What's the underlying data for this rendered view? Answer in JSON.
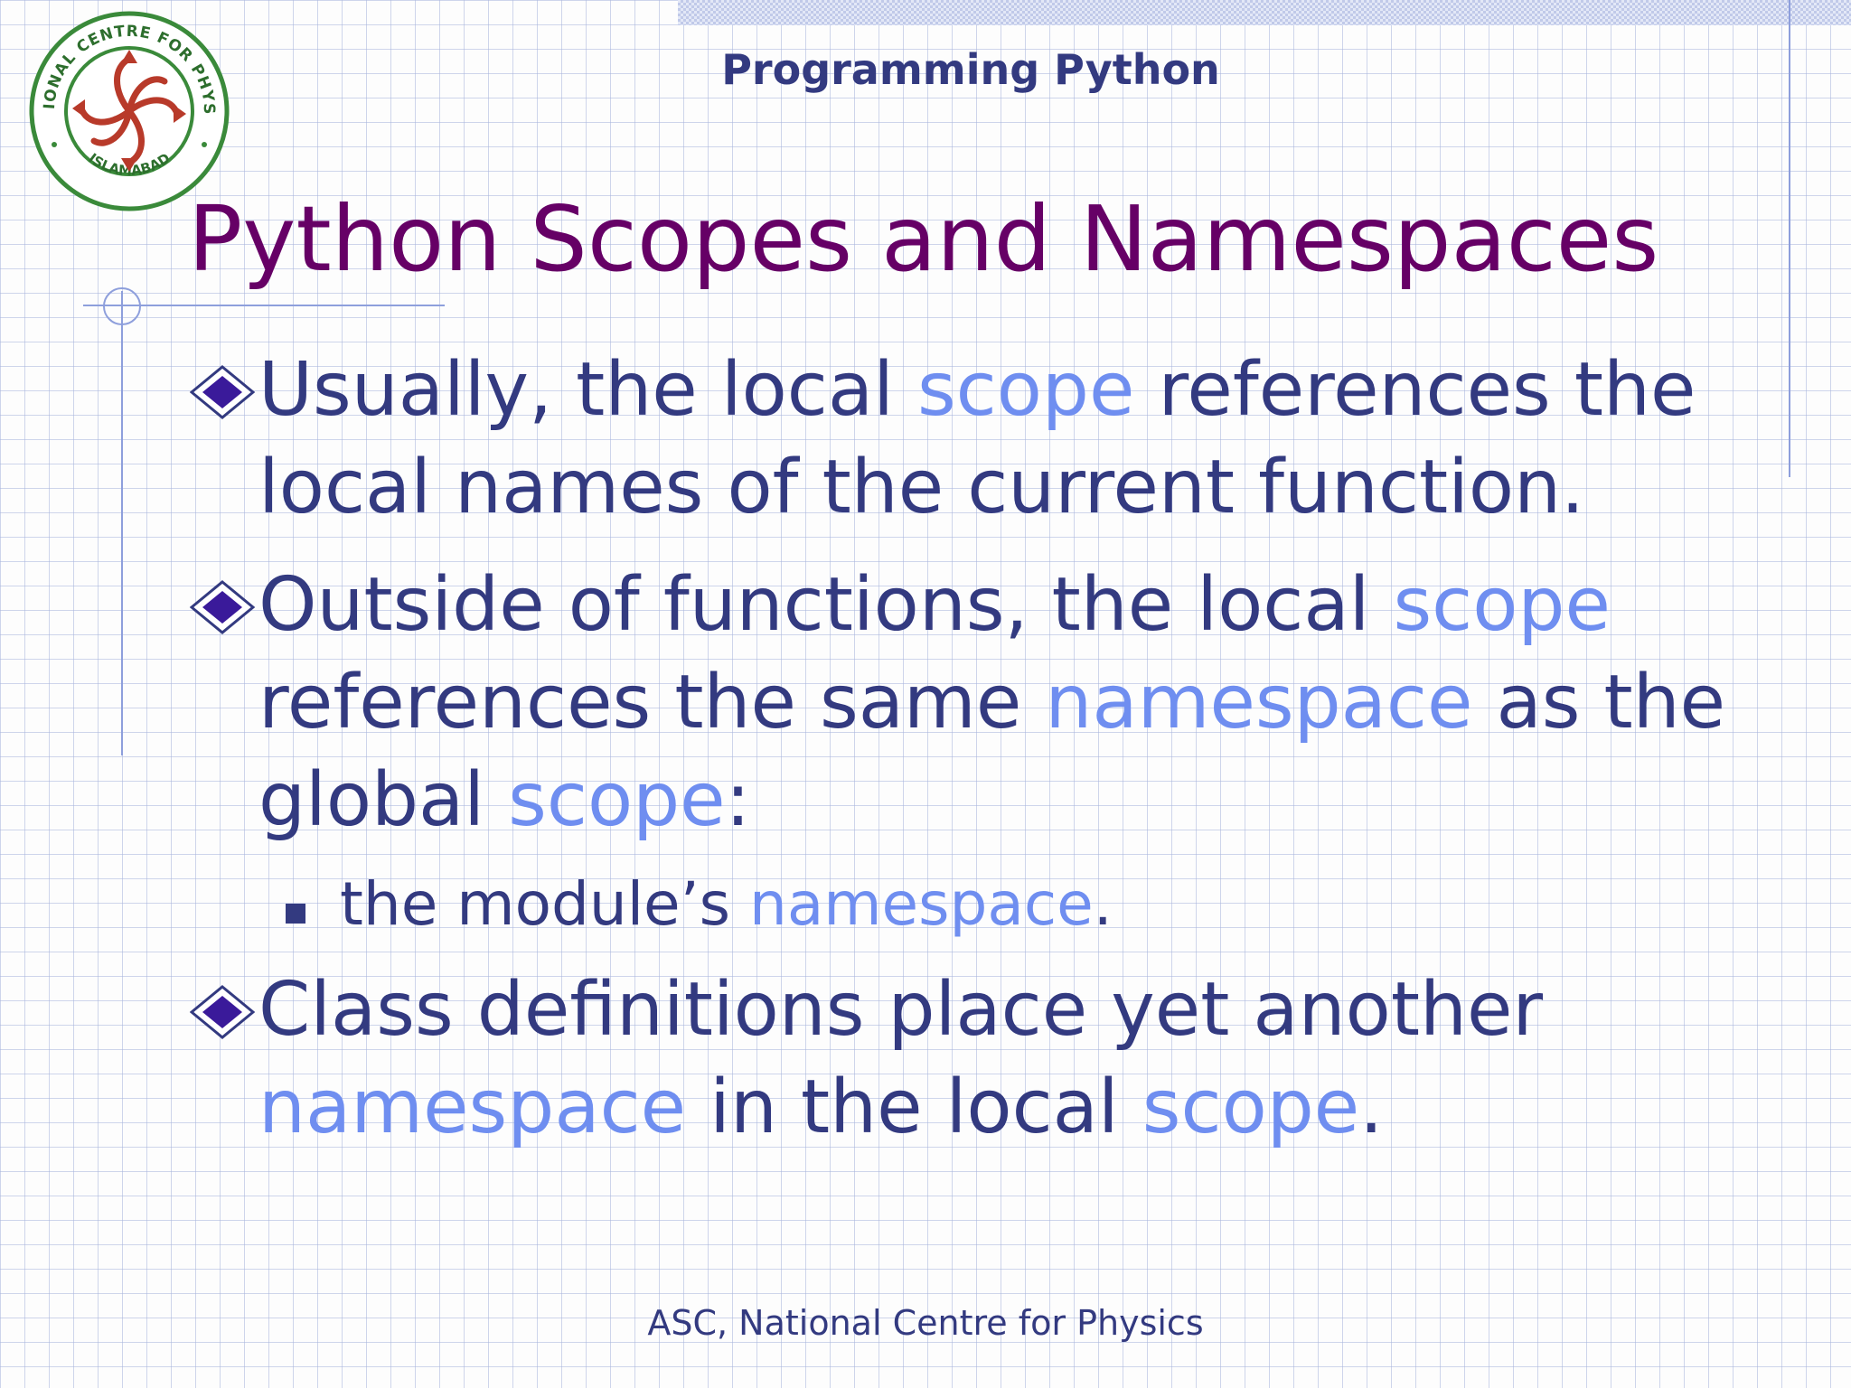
{
  "header": {
    "title": "Programming Python"
  },
  "logo": {
    "top_text": "NATIONAL CENTRE FOR PHYSICS",
    "bottom_text": "ISLAMABAD"
  },
  "slide": {
    "title": "Python Scopes and Namespaces",
    "bullets": [
      {
        "parts": [
          "Usually, the local ",
          "scope",
          " references the local names of the current function."
        ]
      },
      {
        "parts": [
          "Outside of functions, the local ",
          "scope",
          " references the same ",
          "namespace",
          " as the global ",
          "scope",
          ":"
        ]
      },
      {
        "parts": [
          "Class definitions place yet another ",
          "namespace",
          " in the local ",
          "scope",
          "."
        ]
      }
    ],
    "sub_bullet": {
      "parts": [
        "the module’s ",
        "namespace",
        "."
      ]
    }
  },
  "footer": {
    "text": "ASC, National Centre for Physics"
  },
  "colors": {
    "title": "#660066",
    "body_text": "#333a80",
    "highlight": "#6f8ef0",
    "logo_red": "#b83a2a",
    "logo_green": "#3a8a3a"
  }
}
